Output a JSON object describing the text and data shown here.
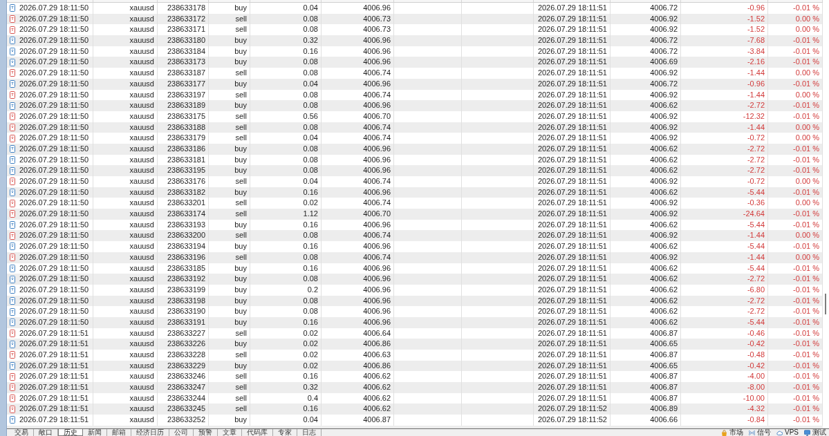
{
  "table": {
    "rows": [
      {
        "kind": "buy",
        "column_1": "2026.07.29 18:11:50",
        "column_2": "xauusd",
        "column_3": "238633178",
        "column_4": "buy",
        "column_5": "0.04",
        "column_6": "4006.96",
        "column_9": "2026.07.29 18:11:51",
        "column_10": "4006.72",
        "column_11": "-0.96",
        "column_12": "-0.01 %"
      },
      {
        "kind": "sell",
        "column_1": "2026.07.29 18:11:50",
        "column_2": "xauusd",
        "column_3": "238633172",
        "column_4": "sell",
        "column_5": "0.08",
        "column_6": "4006.73",
        "column_9": "2026.07.29 18:11:51",
        "column_10": "4006.92",
        "column_11": "-1.52",
        "column_12": "0.00 %"
      },
      {
        "kind": "sell",
        "column_1": "2026.07.29 18:11:50",
        "column_2": "xauusd",
        "column_3": "238633171",
        "column_4": "sell",
        "column_5": "0.08",
        "column_6": "4006.73",
        "column_9": "2026.07.29 18:11:51",
        "column_10": "4006.92",
        "column_11": "-1.52",
        "column_12": "0.00 %"
      },
      {
        "kind": "buy",
        "column_1": "2026.07.29 18:11:50",
        "column_2": "xauusd",
        "column_3": "238633180",
        "column_4": "buy",
        "column_5": "0.32",
        "column_6": "4006.96",
        "column_9": "2026.07.29 18:11:51",
        "column_10": "4006.72",
        "column_11": "-7.68",
        "column_12": "-0.01 %"
      },
      {
        "kind": "buy",
        "column_1": "2026.07.29 18:11:50",
        "column_2": "xauusd",
        "column_3": "238633184",
        "column_4": "buy",
        "column_5": "0.16",
        "column_6": "4006.96",
        "column_9": "2026.07.29 18:11:51",
        "column_10": "4006.72",
        "column_11": "-3.84",
        "column_12": "-0.01 %"
      },
      {
        "kind": "buy",
        "column_1": "2026.07.29 18:11:50",
        "column_2": "xauusd",
        "column_3": "238633173",
        "column_4": "buy",
        "column_5": "0.08",
        "column_6": "4006.96",
        "column_9": "2026.07.29 18:11:51",
        "column_10": "4006.69",
        "column_11": "-2.16",
        "column_12": "-0.01 %"
      },
      {
        "kind": "sell",
        "column_1": "2026.07.29 18:11:50",
        "column_2": "xauusd",
        "column_3": "238633187",
        "column_4": "sell",
        "column_5": "0.08",
        "column_6": "4006.74",
        "column_9": "2026.07.29 18:11:51",
        "column_10": "4006.92",
        "column_11": "-1.44",
        "column_12": "0.00 %"
      },
      {
        "kind": "buy",
        "column_1": "2026.07.29 18:11:50",
        "column_2": "xauusd",
        "column_3": "238633177",
        "column_4": "buy",
        "column_5": "0.04",
        "column_6": "4006.96",
        "column_9": "2026.07.29 18:11:51",
        "column_10": "4006.72",
        "column_11": "-0.96",
        "column_12": "-0.01 %"
      },
      {
        "kind": "sell",
        "column_1": "2026.07.29 18:11:50",
        "column_2": "xauusd",
        "column_3": "238633197",
        "column_4": "sell",
        "column_5": "0.08",
        "column_6": "4006.74",
        "column_9": "2026.07.29 18:11:51",
        "column_10": "4006.92",
        "column_11": "-1.44",
        "column_12": "0.00 %"
      },
      {
        "kind": "buy",
        "column_1": "2026.07.29 18:11:50",
        "column_2": "xauusd",
        "column_3": "238633189",
        "column_4": "buy",
        "column_5": "0.08",
        "column_6": "4006.96",
        "column_9": "2026.07.29 18:11:51",
        "column_10": "4006.62",
        "column_11": "-2.72",
        "column_12": "-0.01 %"
      },
      {
        "kind": "sell",
        "column_1": "2026.07.29 18:11:50",
        "column_2": "xauusd",
        "column_3": "238633175",
        "column_4": "sell",
        "column_5": "0.56",
        "column_6": "4006.70",
        "column_9": "2026.07.29 18:11:51",
        "column_10": "4006.92",
        "column_11": "-12.32",
        "column_12": "-0.01 %"
      },
      {
        "kind": "sell",
        "column_1": "2026.07.29 18:11:50",
        "column_2": "xauusd",
        "column_3": "238633188",
        "column_4": "sell",
        "column_5": "0.08",
        "column_6": "4006.74",
        "column_9": "2026.07.29 18:11:51",
        "column_10": "4006.92",
        "column_11": "-1.44",
        "column_12": "0.00 %"
      },
      {
        "kind": "sell",
        "column_1": "2026.07.29 18:11:50",
        "column_2": "xauusd",
        "column_3": "238633179",
        "column_4": "sell",
        "column_5": "0.04",
        "column_6": "4006.74",
        "column_9": "2026.07.29 18:11:51",
        "column_10": "4006.92",
        "column_11": "-0.72",
        "column_12": "0.00 %"
      },
      {
        "kind": "buy",
        "column_1": "2026.07.29 18:11:50",
        "column_2": "xauusd",
        "column_3": "238633186",
        "column_4": "buy",
        "column_5": "0.08",
        "column_6": "4006.96",
        "column_9": "2026.07.29 18:11:51",
        "column_10": "4006.62",
        "column_11": "-2.72",
        "column_12": "-0.01 %"
      },
      {
        "kind": "buy",
        "column_1": "2026.07.29 18:11:50",
        "column_2": "xauusd",
        "column_3": "238633181",
        "column_4": "buy",
        "column_5": "0.08",
        "column_6": "4006.96",
        "column_9": "2026.07.29 18:11:51",
        "column_10": "4006.62",
        "column_11": "-2.72",
        "column_12": "-0.01 %"
      },
      {
        "kind": "buy",
        "column_1": "2026.07.29 18:11:50",
        "column_2": "xauusd",
        "column_3": "238633195",
        "column_4": "buy",
        "column_5": "0.08",
        "column_6": "4006.96",
        "column_9": "2026.07.29 18:11:51",
        "column_10": "4006.62",
        "column_11": "-2.72",
        "column_12": "-0.01 %"
      },
      {
        "kind": "sell",
        "column_1": "2026.07.29 18:11:50",
        "column_2": "xauusd",
        "column_3": "238633176",
        "column_4": "sell",
        "column_5": "0.04",
        "column_6": "4006.74",
        "column_9": "2026.07.29 18:11:51",
        "column_10": "4006.92",
        "column_11": "-0.72",
        "column_12": "0.00 %"
      },
      {
        "kind": "buy",
        "column_1": "2026.07.29 18:11:50",
        "column_2": "xauusd",
        "column_3": "238633182",
        "column_4": "buy",
        "column_5": "0.16",
        "column_6": "4006.96",
        "column_9": "2026.07.29 18:11:51",
        "column_10": "4006.62",
        "column_11": "-5.44",
        "column_12": "-0.01 %"
      },
      {
        "kind": "sell",
        "column_1": "2026.07.29 18:11:50",
        "column_2": "xauusd",
        "column_3": "238633201",
        "column_4": "sell",
        "column_5": "0.02",
        "column_6": "4006.74",
        "column_9": "2026.07.29 18:11:51",
        "column_10": "4006.92",
        "column_11": "-0.36",
        "column_12": "0.00 %"
      },
      {
        "kind": "sell",
        "column_1": "2026.07.29 18:11:50",
        "column_2": "xauusd",
        "column_3": "238633174",
        "column_4": "sell",
        "column_5": "1.12",
        "column_6": "4006.70",
        "column_9": "2026.07.29 18:11:51",
        "column_10": "4006.92",
        "column_11": "-24.64",
        "column_12": "-0.01 %"
      },
      {
        "kind": "buy",
        "column_1": "2026.07.29 18:11:50",
        "column_2": "xauusd",
        "column_3": "238633193",
        "column_4": "buy",
        "column_5": "0.16",
        "column_6": "4006.96",
        "column_9": "2026.07.29 18:11:51",
        "column_10": "4006.62",
        "column_11": "-5.44",
        "column_12": "-0.01 %"
      },
      {
        "kind": "sell",
        "column_1": "2026.07.29 18:11:50",
        "column_2": "xauusd",
        "column_3": "238633200",
        "column_4": "sell",
        "column_5": "0.08",
        "column_6": "4006.74",
        "column_9": "2026.07.29 18:11:51",
        "column_10": "4006.92",
        "column_11": "-1.44",
        "column_12": "0.00 %"
      },
      {
        "kind": "buy",
        "column_1": "2026.07.29 18:11:50",
        "column_2": "xauusd",
        "column_3": "238633194",
        "column_4": "buy",
        "column_5": "0.16",
        "column_6": "4006.96",
        "column_9": "2026.07.29 18:11:51",
        "column_10": "4006.62",
        "column_11": "-5.44",
        "column_12": "-0.01 %"
      },
      {
        "kind": "sell",
        "column_1": "2026.07.29 18:11:50",
        "column_2": "xauusd",
        "column_3": "238633196",
        "column_4": "sell",
        "column_5": "0.08",
        "column_6": "4006.74",
        "column_9": "2026.07.29 18:11:51",
        "column_10": "4006.92",
        "column_11": "-1.44",
        "column_12": "0.00 %"
      },
      {
        "kind": "buy",
        "column_1": "2026.07.29 18:11:50",
        "column_2": "xauusd",
        "column_3": "238633185",
        "column_4": "buy",
        "column_5": "0.16",
        "column_6": "4006.96",
        "column_9": "2026.07.29 18:11:51",
        "column_10": "4006.62",
        "column_11": "-5.44",
        "column_12": "-0.01 %"
      },
      {
        "kind": "buy",
        "column_1": "2026.07.29 18:11:50",
        "column_2": "xauusd",
        "column_3": "238633192",
        "column_4": "buy",
        "column_5": "0.08",
        "column_6": "4006.96",
        "column_9": "2026.07.29 18:11:51",
        "column_10": "4006.62",
        "column_11": "-2.72",
        "column_12": "-0.01 %"
      },
      {
        "kind": "buy",
        "column_1": "2026.07.29 18:11:50",
        "column_2": "xauusd",
        "column_3": "238633199",
        "column_4": "buy",
        "column_5": "0.2",
        "column_6": "4006.96",
        "column_9": "2026.07.29 18:11:51",
        "column_10": "4006.62",
        "column_11": "-6.80",
        "column_12": "-0.01 %"
      },
      {
        "kind": "buy",
        "column_1": "2026.07.29 18:11:50",
        "column_2": "xauusd",
        "column_3": "238633198",
        "column_4": "buy",
        "column_5": "0.08",
        "column_6": "4006.96",
        "column_9": "2026.07.29 18:11:51",
        "column_10": "4006.62",
        "column_11": "-2.72",
        "column_12": "-0.01 %"
      },
      {
        "kind": "buy",
        "column_1": "2026.07.29 18:11:50",
        "column_2": "xauusd",
        "column_3": "238633190",
        "column_4": "buy",
        "column_5": "0.08",
        "column_6": "4006.96",
        "column_9": "2026.07.29 18:11:51",
        "column_10": "4006.62",
        "column_11": "-2.72",
        "column_12": "-0.01 %"
      },
      {
        "kind": "buy",
        "column_1": "2026.07.29 18:11:50",
        "column_2": "xauusd",
        "column_3": "238633191",
        "column_4": "buy",
        "column_5": "0.16",
        "column_6": "4006.96",
        "column_9": "2026.07.29 18:11:51",
        "column_10": "4006.62",
        "column_11": "-5.44",
        "column_12": "-0.01 %"
      },
      {
        "kind": "sell",
        "column_1": "2026.07.29 18:11:51",
        "column_2": "xauusd",
        "column_3": "238633227",
        "column_4": "sell",
        "column_5": "0.02",
        "column_6": "4006.64",
        "column_9": "2026.07.29 18:11:51",
        "column_10": "4006.87",
        "column_11": "-0.46",
        "column_12": "-0.01 %"
      },
      {
        "kind": "buy",
        "column_1": "2026.07.29 18:11:51",
        "column_2": "xauusd",
        "column_3": "238633226",
        "column_4": "buy",
        "column_5": "0.02",
        "column_6": "4006.86",
        "column_9": "2026.07.29 18:11:51",
        "column_10": "4006.65",
        "column_11": "-0.42",
        "column_12": "-0.01 %"
      },
      {
        "kind": "sell",
        "column_1": "2026.07.29 18:11:51",
        "column_2": "xauusd",
        "column_3": "238633228",
        "column_4": "sell",
        "column_5": "0.02",
        "column_6": "4006.63",
        "column_9": "2026.07.29 18:11:51",
        "column_10": "4006.87",
        "column_11": "-0.48",
        "column_12": "-0.01 %"
      },
      {
        "kind": "buy",
        "column_1": "2026.07.29 18:11:51",
        "column_2": "xauusd",
        "column_3": "238633229",
        "column_4": "buy",
        "column_5": "0.02",
        "column_6": "4006.86",
        "column_9": "2026.07.29 18:11:51",
        "column_10": "4006.65",
        "column_11": "-0.42",
        "column_12": "-0.01 %"
      },
      {
        "kind": "sell",
        "column_1": "2026.07.29 18:11:51",
        "column_2": "xauusd",
        "column_3": "238633246",
        "column_4": "sell",
        "column_5": "0.16",
        "column_6": "4006.62",
        "column_9": "2026.07.29 18:11:51",
        "column_10": "4006.87",
        "column_11": "-4.00",
        "column_12": "-0.01 %"
      },
      {
        "kind": "sell",
        "column_1": "2026.07.29 18:11:51",
        "column_2": "xauusd",
        "column_3": "238633247",
        "column_4": "sell",
        "column_5": "0.32",
        "column_6": "4006.62",
        "column_9": "2026.07.29 18:11:51",
        "column_10": "4006.87",
        "column_11": "-8.00",
        "column_12": "-0.01 %"
      },
      {
        "kind": "sell",
        "column_1": "2026.07.29 18:11:51",
        "column_2": "xauusd",
        "column_3": "238633244",
        "column_4": "sell",
        "column_5": "0.4",
        "column_6": "4006.62",
        "column_9": "2026.07.29 18:11:51",
        "column_10": "4006.87",
        "column_11": "-10.00",
        "column_12": "-0.01 %"
      },
      {
        "kind": "sell",
        "column_1": "2026.07.29 18:11:51",
        "column_2": "xauusd",
        "column_3": "238633245",
        "column_4": "sell",
        "column_5": "0.16",
        "column_6": "4006.62",
        "column_9": "2026.07.29 18:11:52",
        "column_10": "4006.89",
        "column_11": "-4.32",
        "column_12": "-0.01 %"
      },
      {
        "kind": "buy",
        "column_1": "2026.07.29 18:11:51",
        "column_2": "xauusd",
        "column_3": "238633252",
        "column_4": "buy",
        "column_5": "0.04",
        "column_6": "4006.87",
        "column_9": "2026.07.29 18:11:52",
        "column_10": "4006.66",
        "column_11": "-0.84",
        "column_12": "-0.01 %"
      }
    ]
  },
  "bottom_tabs": [
    {
      "label": "交易",
      "selected": false
    },
    {
      "label": "敞口",
      "selected": false
    },
    {
      "label": "历史",
      "selected": true
    },
    {
      "label": "新闻",
      "selected": false
    },
    {
      "label": "邮箱",
      "selected": false
    },
    {
      "label": "经济日历",
      "selected": false
    },
    {
      "label": "公司",
      "selected": false
    },
    {
      "label": "预警",
      "selected": false
    },
    {
      "label": "文章",
      "selected": false
    },
    {
      "label": "代码库",
      "selected": false
    },
    {
      "label": "专家",
      "selected": false
    },
    {
      "label": "日志",
      "selected": false
    }
  ],
  "status_bar": [
    {
      "kind": "market",
      "label": "市场"
    },
    {
      "kind": "signals",
      "label": "信号"
    },
    {
      "kind": "vps",
      "label": "VPS"
    },
    {
      "kind": "tester",
      "label": "测试"
    }
  ]
}
